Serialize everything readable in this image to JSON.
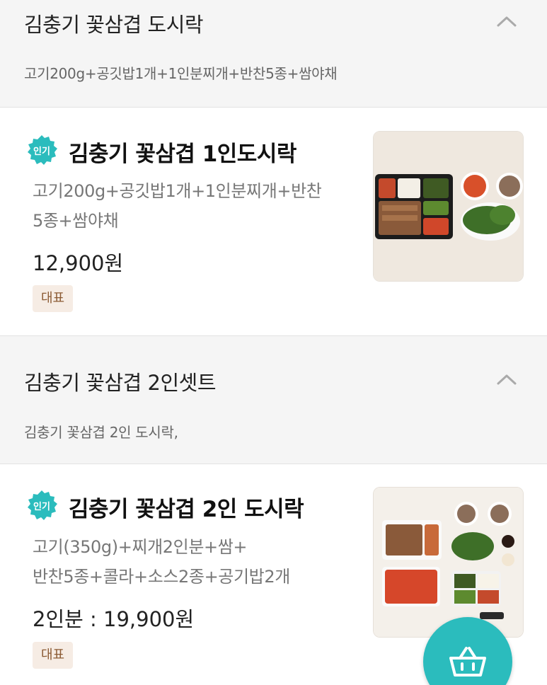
{
  "categories": [
    {
      "title": "김충기 꽃삼겹 도시락",
      "description": "고기200g+공깃밥1개+1인분찌개+반찬5종+쌈야채",
      "item": {
        "badge": "인기",
        "name": "김충기 꽃삼겹 1인도시락",
        "desc_line1": "고기200g+공깃밥1개+1인분찌개+반찬",
        "desc_line2": "5종+쌈야채",
        "price": "12,900원",
        "tag": "대표"
      }
    },
    {
      "title": "김충기 꽃삼겹 2인셋트",
      "description": "김충기 꽃삼겹 2인 도시락,",
      "item": {
        "badge": "인기",
        "name": "김충기 꽃삼겹 2인 도시락",
        "desc_line1": "고기(350g)+찌개2인분+쌈+",
        "desc_line2": "반찬5종+콜라+소스2종+공기밥2개",
        "price": "2인분 : 19,900원",
        "tag": "대표"
      }
    }
  ],
  "icons": {
    "collapse": "chevron-up-icon",
    "badge": "popular-badge-icon",
    "cart": "basket-icon"
  },
  "colors": {
    "accent": "#2bbcbd",
    "tag_bg": "#f6ece4",
    "tag_text": "#8b5a33",
    "header_bg": "#f5f5f5"
  }
}
